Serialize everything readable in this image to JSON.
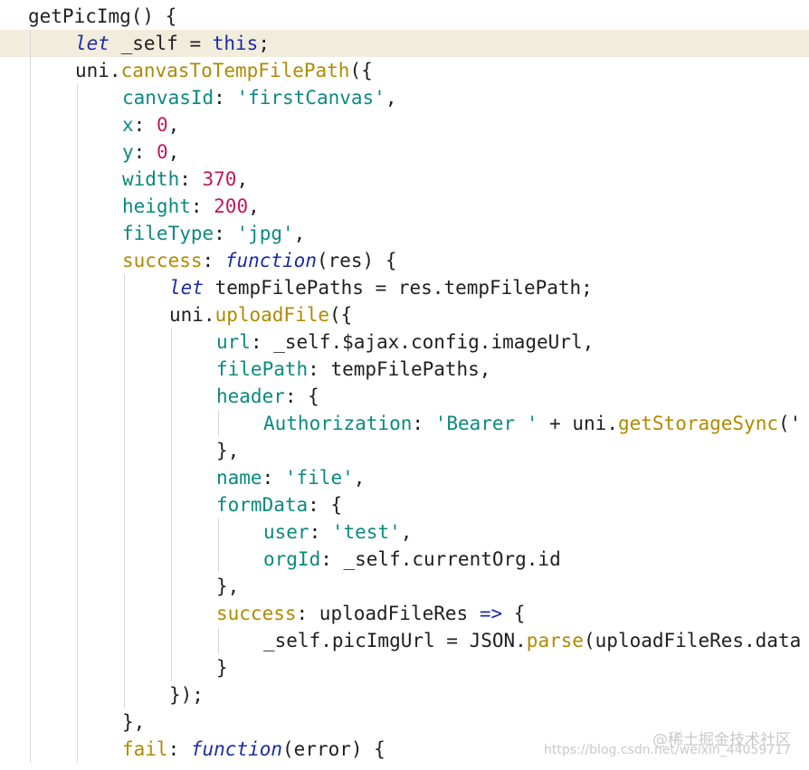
{
  "code_lines": [
    {
      "indent": 0,
      "tokens": [
        {
          "t": "getPicImg() {",
          "c": "ident"
        }
      ]
    },
    {
      "indent": 1,
      "current": true,
      "tokens": [
        {
          "t": "let",
          "c": "kw"
        },
        {
          "t": " _self = ",
          "c": "ident"
        },
        {
          "t": "this",
          "c": "kwn"
        },
        {
          "t": ";",
          "c": "punct"
        }
      ]
    },
    {
      "indent": 1,
      "tokens": [
        {
          "t": "uni.",
          "c": "ident"
        },
        {
          "t": "canvasToTempFilePath",
          "c": "method"
        },
        {
          "t": "({",
          "c": "punct"
        }
      ]
    },
    {
      "indent": 2,
      "tokens": [
        {
          "t": "canvasId",
          "c": "prop"
        },
        {
          "t": ": ",
          "c": "punct"
        },
        {
          "t": "'firstCanvas'",
          "c": "string"
        },
        {
          "t": ",",
          "c": "punct"
        }
      ]
    },
    {
      "indent": 2,
      "tokens": [
        {
          "t": "x",
          "c": "prop"
        },
        {
          "t": ": ",
          "c": "punct"
        },
        {
          "t": "0",
          "c": "number"
        },
        {
          "t": ",",
          "c": "punct"
        }
      ]
    },
    {
      "indent": 2,
      "tokens": [
        {
          "t": "y",
          "c": "prop"
        },
        {
          "t": ": ",
          "c": "punct"
        },
        {
          "t": "0",
          "c": "number"
        },
        {
          "t": ",",
          "c": "punct"
        }
      ]
    },
    {
      "indent": 2,
      "tokens": [
        {
          "t": "width",
          "c": "prop"
        },
        {
          "t": ": ",
          "c": "punct"
        },
        {
          "t": "370",
          "c": "number"
        },
        {
          "t": ",",
          "c": "punct"
        }
      ]
    },
    {
      "indent": 2,
      "tokens": [
        {
          "t": "height",
          "c": "prop"
        },
        {
          "t": ": ",
          "c": "punct"
        },
        {
          "t": "200",
          "c": "number"
        },
        {
          "t": ",",
          "c": "punct"
        }
      ]
    },
    {
      "indent": 2,
      "tokens": [
        {
          "t": "fileType",
          "c": "prop"
        },
        {
          "t": ": ",
          "c": "punct"
        },
        {
          "t": "'jpg'",
          "c": "string"
        },
        {
          "t": ",",
          "c": "punct"
        }
      ]
    },
    {
      "indent": 2,
      "tokens": [
        {
          "t": "success",
          "c": "method"
        },
        {
          "t": ": ",
          "c": "punct"
        },
        {
          "t": "function",
          "c": "kw"
        },
        {
          "t": "(res) {",
          "c": "ident"
        }
      ]
    },
    {
      "indent": 3,
      "tokens": [
        {
          "t": "let",
          "c": "kw"
        },
        {
          "t": " tempFilePaths = res.",
          "c": "ident"
        },
        {
          "t": "tempFilePath",
          "c": "ident"
        },
        {
          "t": ";",
          "c": "punct"
        }
      ]
    },
    {
      "indent": 3,
      "tokens": [
        {
          "t": "uni.",
          "c": "ident"
        },
        {
          "t": "uploadFile",
          "c": "method"
        },
        {
          "t": "({",
          "c": "punct"
        }
      ]
    },
    {
      "indent": 4,
      "tokens": [
        {
          "t": "url",
          "c": "prop"
        },
        {
          "t": ": _self.$ajax.config.imageUrl,",
          "c": "ident"
        }
      ]
    },
    {
      "indent": 4,
      "tokens": [
        {
          "t": "filePath",
          "c": "prop"
        },
        {
          "t": ": tempFilePaths,",
          "c": "ident"
        }
      ]
    },
    {
      "indent": 4,
      "tokens": [
        {
          "t": "header",
          "c": "prop"
        },
        {
          "t": ": {",
          "c": "punct"
        }
      ]
    },
    {
      "indent": 5,
      "tokens": [
        {
          "t": "Authorization",
          "c": "prop"
        },
        {
          "t": ": ",
          "c": "punct"
        },
        {
          "t": "'Bearer '",
          "c": "string"
        },
        {
          "t": " + uni.",
          "c": "ident"
        },
        {
          "t": "getStorageSync",
          "c": "method"
        },
        {
          "t": "('",
          "c": "punct"
        }
      ]
    },
    {
      "indent": 4,
      "tokens": [
        {
          "t": "},",
          "c": "punct"
        }
      ]
    },
    {
      "indent": 4,
      "tokens": [
        {
          "t": "name",
          "c": "prop"
        },
        {
          "t": ": ",
          "c": "punct"
        },
        {
          "t": "'file'",
          "c": "string"
        },
        {
          "t": ",",
          "c": "punct"
        }
      ]
    },
    {
      "indent": 4,
      "tokens": [
        {
          "t": "formData",
          "c": "prop"
        },
        {
          "t": ": {",
          "c": "punct"
        }
      ]
    },
    {
      "indent": 5,
      "tokens": [
        {
          "t": "user",
          "c": "prop"
        },
        {
          "t": ": ",
          "c": "punct"
        },
        {
          "t": "'test'",
          "c": "string"
        },
        {
          "t": ",",
          "c": "punct"
        }
      ]
    },
    {
      "indent": 5,
      "tokens": [
        {
          "t": "orgId",
          "c": "prop"
        },
        {
          "t": ": _self.currentOrg.id",
          "c": "ident"
        }
      ]
    },
    {
      "indent": 4,
      "tokens": [
        {
          "t": "},",
          "c": "punct"
        }
      ]
    },
    {
      "indent": 4,
      "tokens": [
        {
          "t": "success",
          "c": "method"
        },
        {
          "t": ": uploadFileRes ",
          "c": "ident"
        },
        {
          "t": "=>",
          "c": "kwn"
        },
        {
          "t": " {",
          "c": "punct"
        }
      ]
    },
    {
      "indent": 5,
      "tokens": [
        {
          "t": "_self.picImgUrl = JSON.",
          "c": "ident"
        },
        {
          "t": "parse",
          "c": "method"
        },
        {
          "t": "(uploadFileRes.data",
          "c": "ident"
        }
      ]
    },
    {
      "indent": 4,
      "tokens": [
        {
          "t": "}",
          "c": "punct"
        }
      ]
    },
    {
      "indent": 3,
      "tokens": [
        {
          "t": "});",
          "c": "punct"
        }
      ]
    },
    {
      "indent": 2,
      "tokens": [
        {
          "t": "},",
          "c": "punct"
        }
      ]
    },
    {
      "indent": 2,
      "tokens": [
        {
          "t": "fail",
          "c": "method"
        },
        {
          "t": ": ",
          "c": "punct"
        },
        {
          "t": "function",
          "c": "kw"
        },
        {
          "t": "(error) {",
          "c": "ident"
        }
      ]
    }
  ],
  "watermark": {
    "line1": "@稀土掘金技术社区",
    "line2": "https://blog.csdn.net/weixin_44059717"
  },
  "colors": {
    "keyword": "#1a2ba8",
    "property": "#0b8a7f",
    "method": "#b08a00",
    "number": "#c2185b",
    "current_line": "#f2ecdc"
  }
}
